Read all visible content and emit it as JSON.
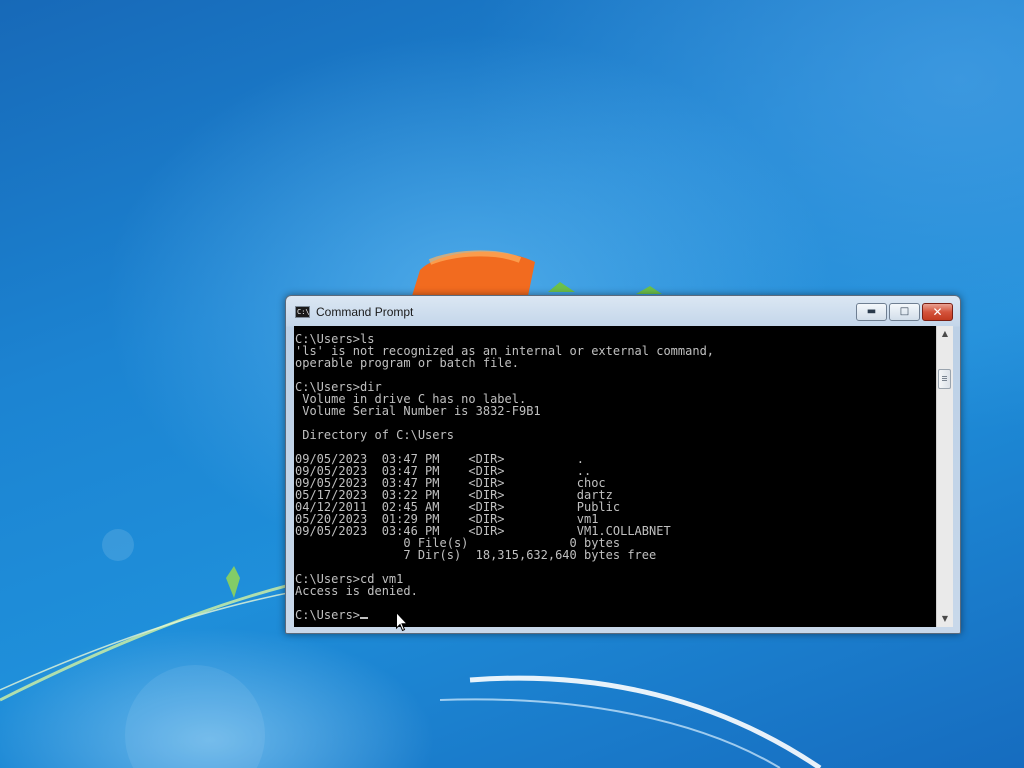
{
  "window": {
    "title": "Command Prompt",
    "icon_name": "cmd-icon",
    "icon_glyph": "C:\\",
    "controls": {
      "minimize": "minimize-icon",
      "maximize": "maximize-icon",
      "close": "close-icon"
    }
  },
  "console": {
    "cursor": "_",
    "lines": [
      "C:\\Users>ls",
      "'ls' is not recognized as an internal or external command,",
      "operable program or batch file.",
      "",
      "C:\\Users>dir",
      " Volume in drive C has no label.",
      " Volume Serial Number is 3832-F9B1",
      "",
      " Directory of C:\\Users",
      "",
      "09/05/2023  03:47 PM    <DIR>          .",
      "09/05/2023  03:47 PM    <DIR>          ..",
      "09/05/2023  03:47 PM    <DIR>          choc",
      "05/17/2023  03:22 PM    <DIR>          dartz",
      "04/12/2011  02:45 AM    <DIR>          Public",
      "05/20/2023  01:29 PM    <DIR>          vm1",
      "09/05/2023  03:46 PM    <DIR>          VM1.COLLABNET",
      "               0 File(s)              0 bytes",
      "               7 Dir(s)  18,315,632,640 bytes free",
      "",
      "C:\\Users>cd vm1",
      "Access is denied.",
      "",
      "C:\\Users>"
    ]
  },
  "colors": {
    "console_background": "#000000",
    "console_text": "#c0c0c0",
    "desktop_background": "#1c84d2",
    "close_button": "#c8432b"
  }
}
